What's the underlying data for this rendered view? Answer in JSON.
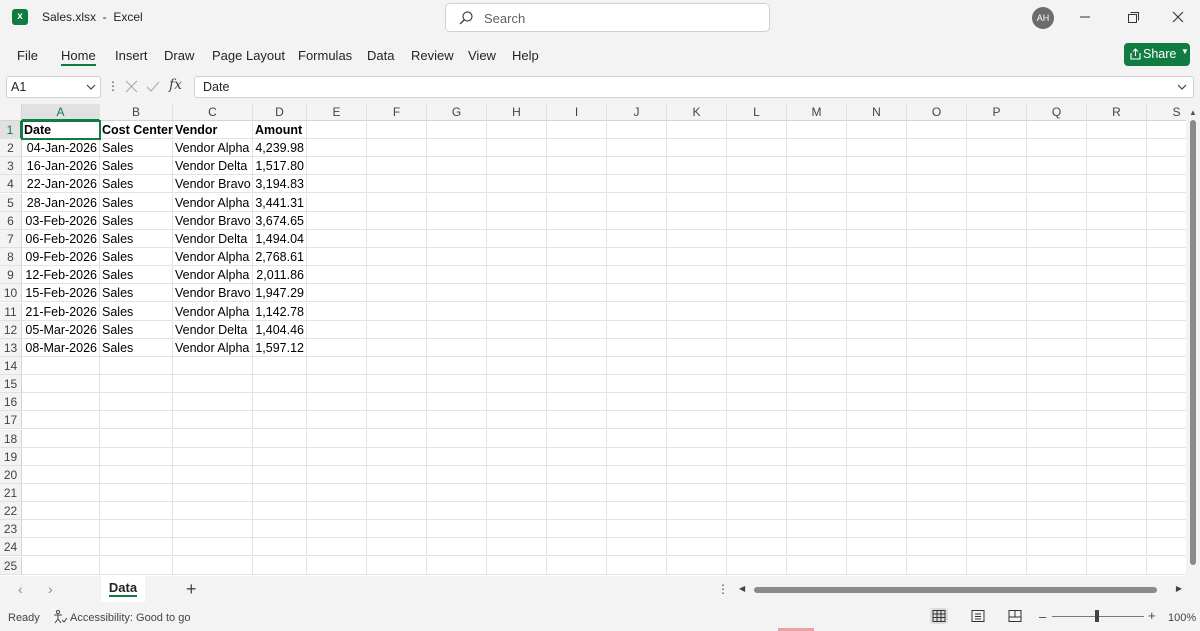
{
  "window": {
    "title": "Sales.xlsx  -  Excel",
    "search_placeholder": "Search",
    "avatar_initials": "AH"
  },
  "menu": {
    "items": [
      "File",
      "Home",
      "Insert",
      "Draw",
      "Page Layout",
      "Formulas",
      "Data",
      "Review",
      "View",
      "Help"
    ],
    "active": "Home",
    "share_label": "Share"
  },
  "formula_bar": {
    "name_box": "A1",
    "fx_label": "fx",
    "content": "Date"
  },
  "grid": {
    "columns": [
      "A",
      "B",
      "C",
      "D",
      "E",
      "F",
      "G",
      "H",
      "I",
      "J",
      "K",
      "L",
      "M",
      "N",
      "O",
      "P",
      "Q",
      "R",
      "S"
    ],
    "row_numbers": [
      "1",
      "2",
      "3",
      "4",
      "5",
      "6",
      "7",
      "8",
      "9",
      "10",
      "11",
      "12",
      "13",
      "14",
      "15",
      "16",
      "17",
      "18",
      "19",
      "20",
      "21",
      "22",
      "23",
      "24",
      "25"
    ],
    "headers": [
      "Date",
      "Cost Center",
      "Vendor",
      "Amount"
    ],
    "rows": [
      [
        "04-Jan-2026",
        "Sales",
        "Vendor Alpha",
        "4,239.98"
      ],
      [
        "16-Jan-2026",
        "Sales",
        "Vendor Delta",
        "1,517.80"
      ],
      [
        "22-Jan-2026",
        "Sales",
        "Vendor Bravo",
        "3,194.83"
      ],
      [
        "28-Jan-2026",
        "Sales",
        "Vendor Alpha",
        "3,441.31"
      ],
      [
        "03-Feb-2026",
        "Sales",
        "Vendor Bravo",
        "3,674.65"
      ],
      [
        "06-Feb-2026",
        "Sales",
        "Vendor Delta",
        "1,494.04"
      ],
      [
        "09-Feb-2026",
        "Sales",
        "Vendor Alpha",
        "2,768.61"
      ],
      [
        "12-Feb-2026",
        "Sales",
        "Vendor Alpha",
        "2,011.86"
      ],
      [
        "15-Feb-2026",
        "Sales",
        "Vendor Bravo",
        "1,947.29"
      ],
      [
        "21-Feb-2026",
        "Sales",
        "Vendor Alpha",
        "1,142.78"
      ],
      [
        "05-Mar-2026",
        "Sales",
        "Vendor Delta",
        "1,404.46"
      ],
      [
        "08-Mar-2026",
        "Sales",
        "Vendor Alpha",
        "1,597.12"
      ]
    ]
  },
  "sheets": {
    "tabs": [
      "Data"
    ],
    "active": "Data"
  },
  "status": {
    "ready": "Ready",
    "accessibility": "Accessibility: Good to go",
    "zoom": "100%"
  },
  "colors": {
    "accent": "#107c41",
    "background": "#f3f3f3"
  }
}
